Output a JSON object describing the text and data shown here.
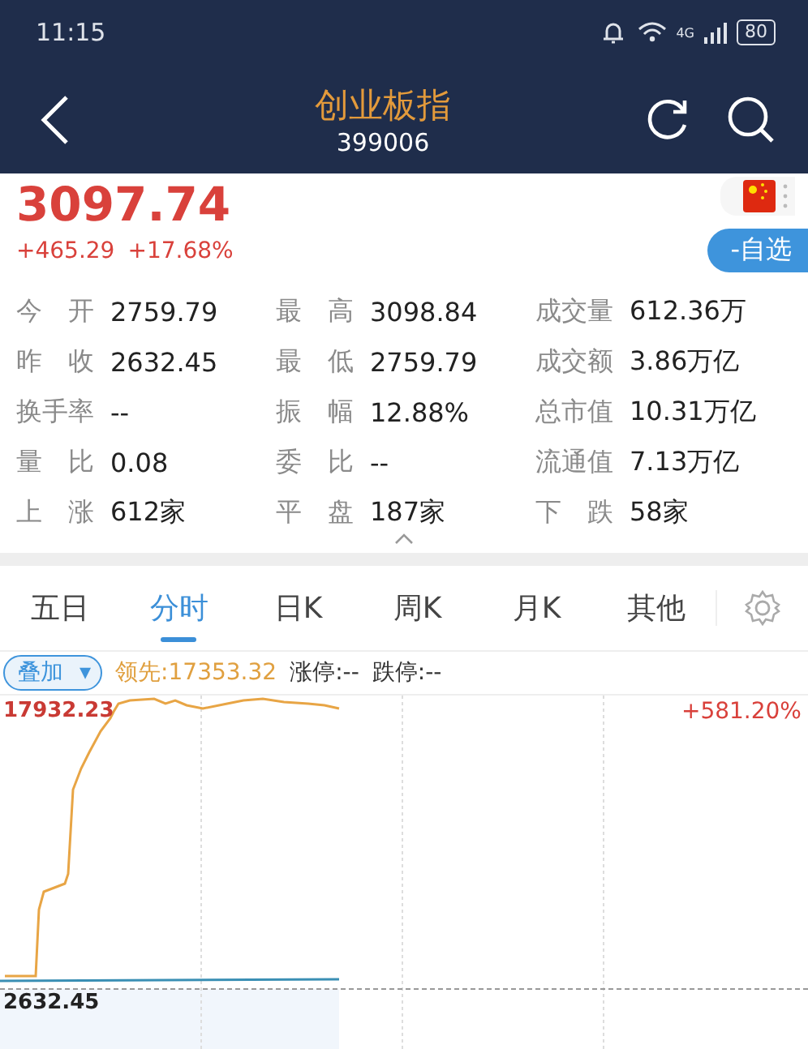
{
  "status_bar": {
    "time": "11:15",
    "network": "4G",
    "battery": "80"
  },
  "header": {
    "title": "创业板指",
    "code": "399006"
  },
  "quote": {
    "price": "3097.74",
    "change": "+465.29",
    "change_pct": "+17.68%",
    "watchlist_button": "-自选"
  },
  "stats": [
    [
      {
        "label": "今 开",
        "value": "2759.79"
      },
      {
        "label": "最 高",
        "value": "3098.84"
      },
      {
        "label": "成交量",
        "value": "612.36万"
      }
    ],
    [
      {
        "label": "昨 收",
        "value": "2632.45"
      },
      {
        "label": "最 低",
        "value": "2759.79"
      },
      {
        "label": "成交额",
        "value": "3.86万亿"
      }
    ],
    [
      {
        "label": "换手率",
        "value": "--"
      },
      {
        "label": "振 幅",
        "value": "12.88%"
      },
      {
        "label": "总市值",
        "value": "10.31万亿"
      }
    ],
    [
      {
        "label": "量 比",
        "value": "0.08"
      },
      {
        "label": "委 比",
        "value": "--"
      },
      {
        "label": "流通值",
        "value": "7.13万亿"
      }
    ],
    [
      {
        "label": "上 涨",
        "value": "612家"
      },
      {
        "label": "平 盘",
        "value": "187家"
      },
      {
        "label": "下 跌",
        "value": "58家"
      }
    ]
  ],
  "tabs": [
    {
      "label": "五日",
      "selected": false
    },
    {
      "label": "分时",
      "selected": true
    },
    {
      "label": "日K",
      "selected": false
    },
    {
      "label": "周K",
      "selected": false
    },
    {
      "label": "月K",
      "selected": false
    },
    {
      "label": "其他",
      "selected": false
    }
  ],
  "legend": {
    "overlay_button": "叠加",
    "caret": "▾",
    "lead": "领先:17353.32",
    "limit_up": "涨停:--",
    "limit_down": "跌停:--"
  },
  "chart": {
    "top_label": "17932.23",
    "bottom_label": "2632.45",
    "right_label": "+581.20%"
  }
}
